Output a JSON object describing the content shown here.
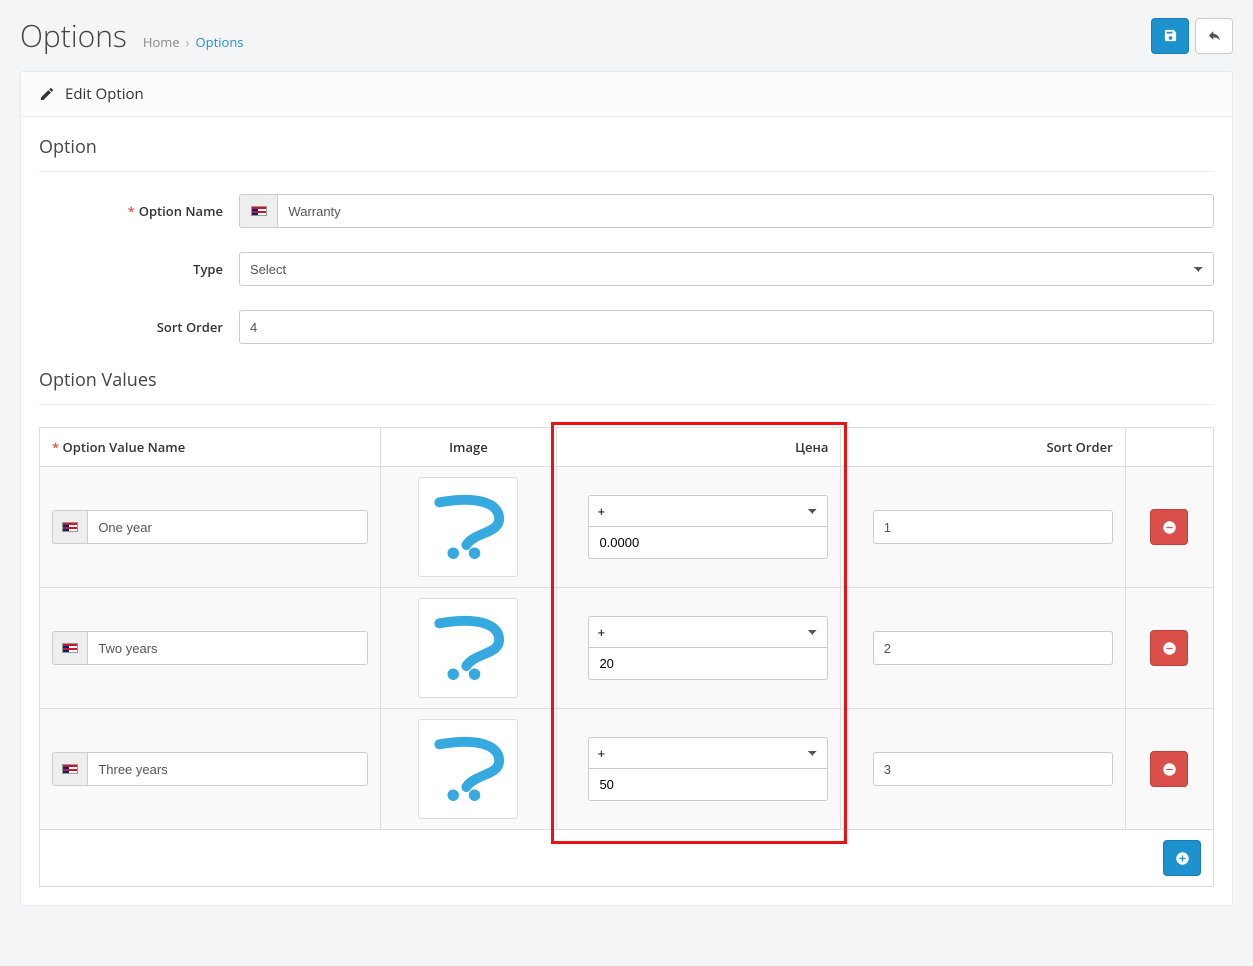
{
  "header": {
    "title": "Options",
    "bc_home": "Home",
    "bc_current": "Options"
  },
  "panel": {
    "heading": "Edit Option",
    "section_option": "Option",
    "section_values": "Option Values",
    "labels": {
      "option_name": "Option Name",
      "type": "Type",
      "sort_order": "Sort Order"
    },
    "fields": {
      "option_name": "Warranty",
      "type": "Select",
      "sort_order": "4"
    },
    "cols": {
      "name": "Option Value Name",
      "image": "Image",
      "price": "Цена",
      "sort": "Sort Order"
    }
  },
  "rows": [
    {
      "name": "One year",
      "price_prefix": "+",
      "price": "0.0000",
      "sort": "1"
    },
    {
      "name": "Two years",
      "price_prefix": "+",
      "price": "20",
      "sort": "2"
    },
    {
      "name": "Three years",
      "price_prefix": "+",
      "price": "50",
      "sort": "3"
    }
  ]
}
